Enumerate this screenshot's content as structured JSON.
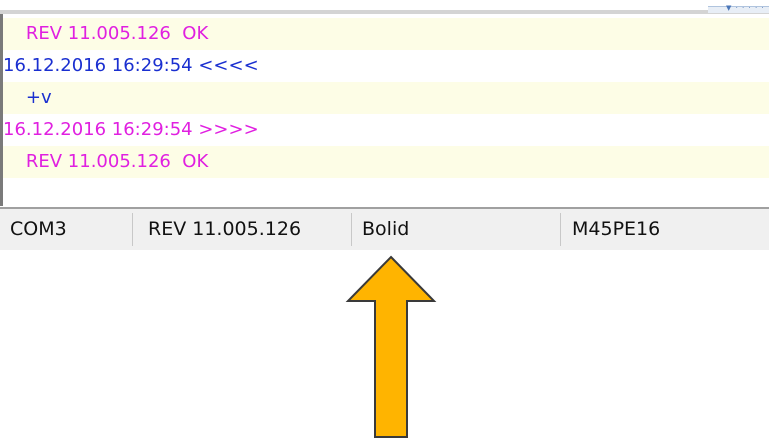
{
  "log": {
    "lines": [
      {
        "text": "    REV 11.005.126  OK",
        "color": "#e020e0",
        "shade": "shaded"
      },
      {
        "text": "16.12.2016 16:29:54 <<<<",
        "color": "#1a2fd0",
        "shade": "plain"
      },
      {
        "text": "    +v",
        "color": "#1a2fd0",
        "shade": "shaded"
      },
      {
        "text": "16.12.2016 16:29:54 >>>>",
        "color": "#e020e0",
        "shade": "plain"
      },
      {
        "text": "    REV 11.005.126  OK",
        "color": "#e020e0",
        "shade": "shaded"
      }
    ]
  },
  "status_bar": {
    "port": "COM3",
    "revision": "REV 11.005.126",
    "device": "Bolid",
    "chip": "M45PE16"
  },
  "colors": {
    "arrow_fill": "#ffb400",
    "arrow_stroke": "#3a3a3a",
    "log_shade": "#fdfde6"
  },
  "icons": {
    "callout": "up-arrow-icon",
    "scroll": "scroll-grip-icon"
  }
}
